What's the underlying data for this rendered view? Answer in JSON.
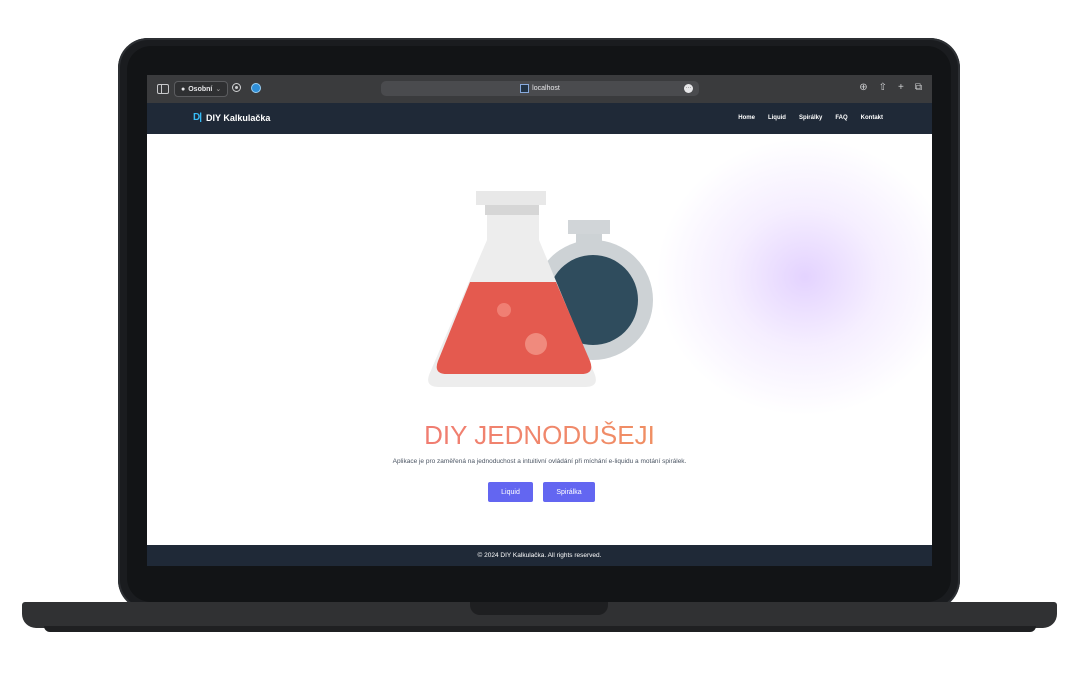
{
  "browser": {
    "profile_label": "Osobní",
    "url": "localhost",
    "more_icon": "ellipsis-icon"
  },
  "navbar": {
    "brand_logo": "D|",
    "brand_name": "DIY Kalkulačka",
    "links": [
      "Home",
      "Liquid",
      "Spirálky",
      "FAQ",
      "Kontakt"
    ]
  },
  "hero": {
    "title": "DIY JEDNODUŠEJI",
    "description": "Aplikace je pro zaměřená na jednoduchost a intuitivní ovládání při míchání e-liquidu a motání spirálek.",
    "buttons": {
      "liquid": "Liquid",
      "spiralka": "Spirálka"
    }
  },
  "footer": {
    "text": "© 2024 DIY Kalkulačka. All rights reserved."
  },
  "colors": {
    "navbar_bg": "#1f2937",
    "button_bg": "#6366f1",
    "title_gradient_start": "#f0647e",
    "title_gradient_end": "#f0a24a",
    "flask_liquid": "#e45a4f",
    "round_flask_liquid": "#2f4c5d"
  }
}
